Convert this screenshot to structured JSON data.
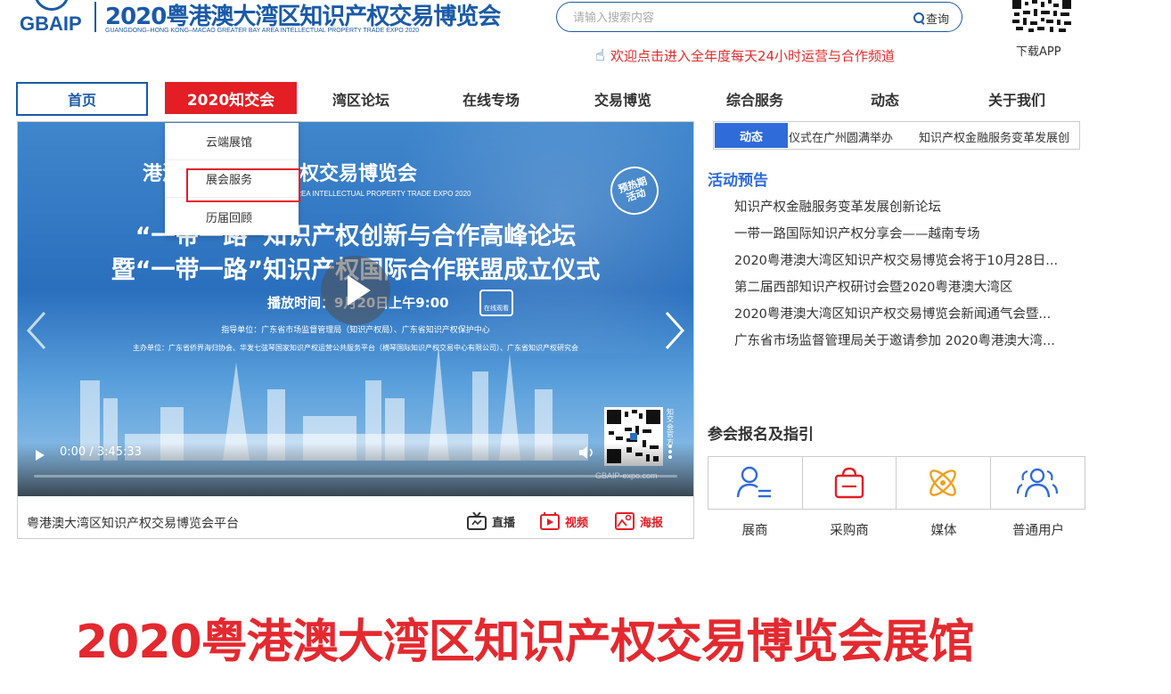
{
  "header": {
    "logo_text": "GBAIP",
    "title": "2020粤港澳大湾区知识产权交易博览会",
    "subtitle": "GUANGDONG–HONG KONG–MACAO GREATER BAY AREA INTELLECTUAL PROPERTY TRADE EXPO 2020",
    "search": {
      "placeholder": "请输入搜索内容",
      "button_label": "查询"
    },
    "welcome_text": "欢迎点击进入全年度每天24小时运营与合作频道",
    "app_label": "下载APP"
  },
  "nav": {
    "items": [
      {
        "label": "首页"
      },
      {
        "label": "2020知交会"
      },
      {
        "label": "湾区论坛"
      },
      {
        "label": "在线专场"
      },
      {
        "label": "交易博览"
      },
      {
        "label": "综合服务"
      },
      {
        "label": "动态"
      },
      {
        "label": "关于我们"
      }
    ],
    "dropdown": [
      {
        "label": "云端展馆"
      },
      {
        "label": "展会服务"
      },
      {
        "label": "历届回顾"
      }
    ]
  },
  "video": {
    "poster_logo": "港澳大湾区知识产权交易博览会",
    "poster_logo_sub": "KONG–MACAO GREATER BAY AREA INTELLECTUAL PROPERTY TRADE EXPO 2020",
    "badge": [
      "预热期",
      "活动"
    ],
    "title_line1": "“一带一路”知识产权创新与合作高峰论坛",
    "title_line2": "暨“一带一路”知识产权国际合作联盟成立仪式",
    "broadcast_time": "播放时间：9月20日上午9:00",
    "watch_online": "在线观看",
    "guide_units": "指导单位：广东省市场监督管理局（知识产权局）、广东省知识产权保护中心",
    "host_units": "主办单位：广东省侨界海归协会、华发七弦琴国家知识产权运营公共服务平台（横琴国际知识产权交易中心有限公司）、广东省知识产权研究会",
    "qr_note": "知交会官方",
    "timecode": "0:00 / 3:45:33",
    "progress": 0.0,
    "watermark": "GBAIP-expo.com",
    "footer_title": "粤港澳大湾区知识产权交易博览会平台",
    "footer_buttons": {
      "live": "直播",
      "video": "视频",
      "poster": "海报"
    }
  },
  "right_panel": {
    "ticker": {
      "label": "动态",
      "text1": "仪式在广州圆满举办",
      "text2": "知识产权金融服务变革发展创"
    },
    "preview_title": "活动预告",
    "preview_items": [
      "知识产权金融服务变革发展创新论坛",
      "一带一路国际知识产权分享会——越南专场",
      "2020粤港澳大湾区知识产权交易博览会将于10月28日...",
      "第二届西部知识产权研讨会暨2020粤港澳大湾区",
      "2020粤港澳大湾区知识产权交易博览会新闻通气会暨...",
      "广东省市场监督管理局关于邀请参加 2020粤港澳大湾..."
    ],
    "registration_title": "参会报名及指引",
    "registration_items": [
      {
        "label": "展商",
        "icon": "exhibitor-icon"
      },
      {
        "label": "采购商",
        "icon": "buyer-icon"
      },
      {
        "label": "媒体",
        "icon": "media-icon"
      },
      {
        "label": "普通用户",
        "icon": "users-icon"
      }
    ]
  },
  "hall_title": "2020粤港澳大湾区知识产权交易博览会展馆",
  "colors": {
    "brand_blue": "#1a5aa8",
    "accent_red": "#e31e24",
    "ticker_blue": "#2f6bd9",
    "title_red": "#e4292f"
  }
}
